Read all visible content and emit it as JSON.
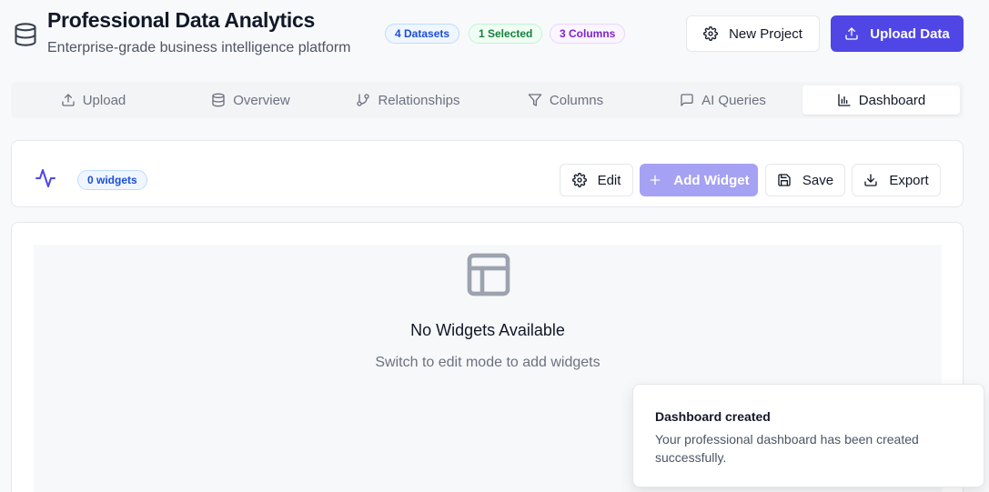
{
  "header": {
    "title": "Professional Data Analytics",
    "subtitle": "Enterprise-grade business intelligence platform",
    "logo_icon": "database-icon",
    "badges": {
      "datasets": "4 Datasets",
      "selected": "1 Selected",
      "columns": "3 Columns"
    },
    "new_project_label": "New Project",
    "upload_label": "Upload Data",
    "accent_color": "#4f46e5"
  },
  "tabs": [
    {
      "label": "Upload",
      "icon": "upload-icon"
    },
    {
      "label": "Overview",
      "icon": "database-icon"
    },
    {
      "label": "Relationships",
      "icon": "git-branch-icon"
    },
    {
      "label": "Columns",
      "icon": "filter-icon"
    },
    {
      "label": "AI Queries",
      "icon": "message-icon"
    },
    {
      "label": "Dashboard",
      "icon": "bar-chart-icon",
      "active": true
    }
  ],
  "toolbar": {
    "widget_count": "0 widgets",
    "edit_label": "Edit",
    "add_widget_label": "Add Widget",
    "save_label": "Save",
    "export_label": "Export"
  },
  "empty_state": {
    "title": "No Widgets Available",
    "subtitle": "Switch to edit mode to add widgets",
    "icon": "layout-icon"
  },
  "toast": {
    "title": "Dashboard created",
    "message": "Your professional dashboard has been created successfully."
  }
}
